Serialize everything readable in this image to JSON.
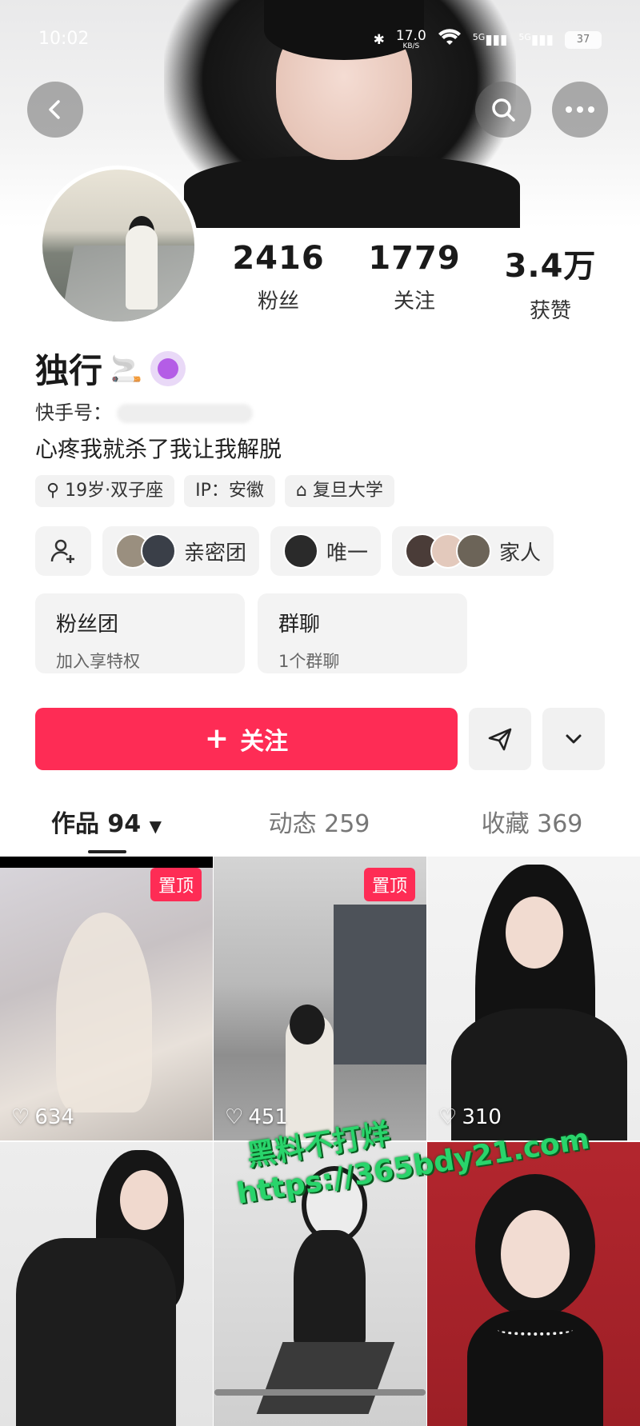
{
  "status": {
    "time": "10:02",
    "speed": "17.0",
    "speed_unit": "KB/S",
    "net1": "5G",
    "net2": "5G",
    "battery": "37"
  },
  "profile": {
    "name": "独行",
    "kuaishou_id_label": "快手号：",
    "bio": "心疼我就杀了我让我解脱",
    "stats": [
      {
        "value": "2416",
        "label": "粉丝"
      },
      {
        "value": "1779",
        "label": "关注"
      },
      {
        "value": "3.4万",
        "label": "获赞"
      }
    ],
    "tags": [
      "19岁·双子座",
      "IP：安徽",
      "复旦大学"
    ]
  },
  "chips": [
    {
      "label": "亲密团"
    },
    {
      "label": "唯一"
    },
    {
      "label": "家人"
    }
  ],
  "cards": [
    {
      "title": "粉丝团",
      "subtitle": "加入享特权"
    },
    {
      "title": "群聊",
      "subtitle": "1个群聊"
    }
  ],
  "actions": {
    "follow_label": "关注"
  },
  "tabs": [
    {
      "label": "作品 94",
      "active": true
    },
    {
      "label": "动态 259",
      "active": false
    },
    {
      "label": "收藏 369",
      "active": false
    }
  ],
  "grid": [
    {
      "pinned": "置顶",
      "likes": "634"
    },
    {
      "pinned": "置顶",
      "likes": "451"
    },
    {
      "pinned": "",
      "likes": "310"
    },
    {
      "pinned": "",
      "likes": ""
    },
    {
      "pinned": "",
      "likes": ""
    },
    {
      "pinned": "",
      "likes": ""
    }
  ],
  "watermark": {
    "line1": "黑料不打烊",
    "line2": "https://365bdy21.com"
  },
  "colors": {
    "accent": "#fe2c55",
    "watermark": "#29d46b"
  }
}
